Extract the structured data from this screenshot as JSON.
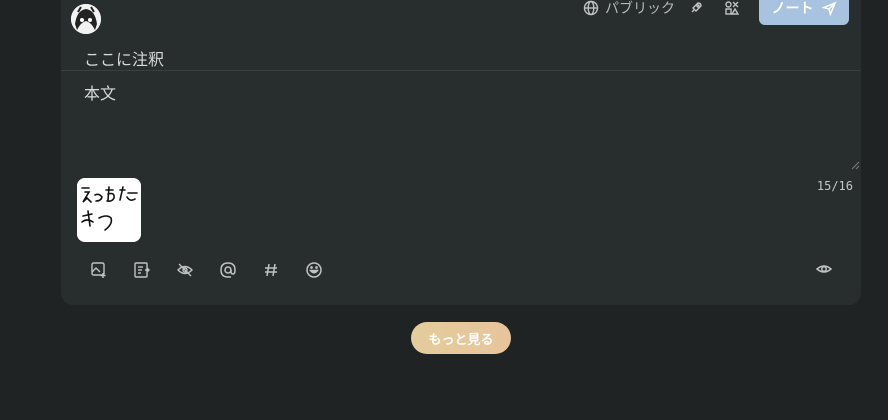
{
  "header": {
    "visibility_label": "パブリック",
    "note_button_label": "ノート"
  },
  "cw": {
    "placeholder": "ここに注釈"
  },
  "body": {
    "placeholder": "本文"
  },
  "counter": "15/16",
  "attachment": {
    "handwriting": "えっちな やつ"
  },
  "footer": {
    "more_label": "もっと見る"
  },
  "colors": {
    "accent": "#a7c3e0",
    "more_button": "#e4cc9c",
    "panel": "#282d2e",
    "background": "#202324"
  }
}
